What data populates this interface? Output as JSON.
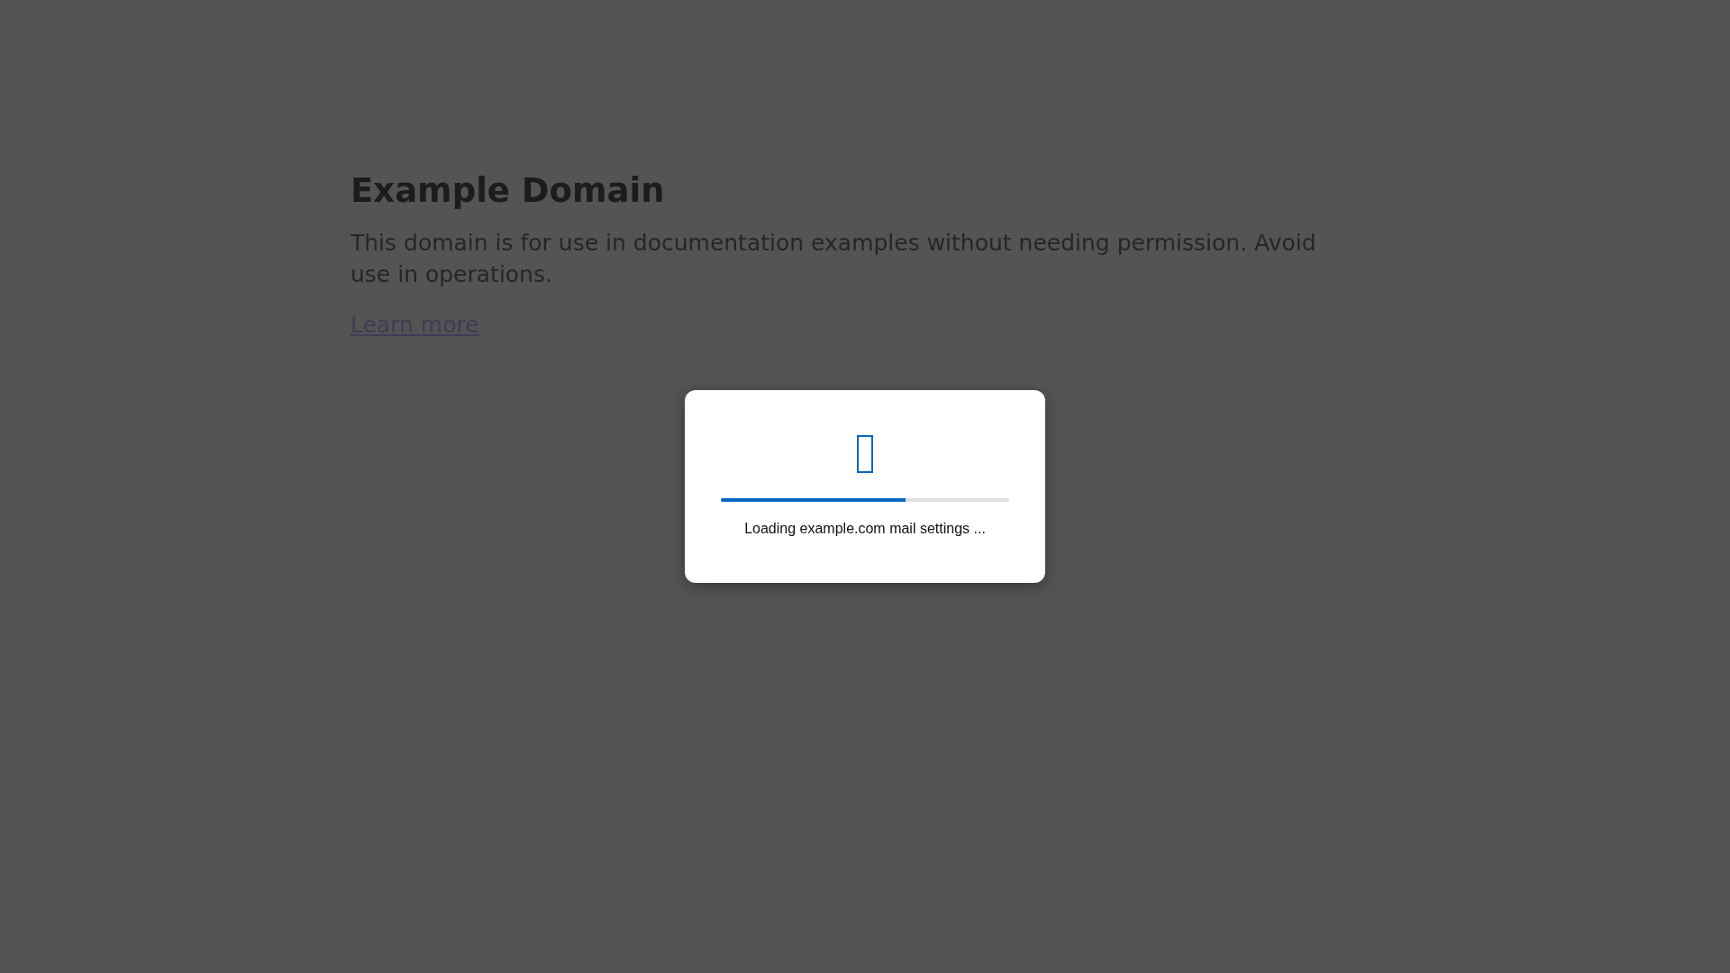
{
  "page": {
    "heading": "Example Domain",
    "paragraph": "This domain is for use in documentation examples without needing permission. Avoid use in operations.",
    "link": "Learn more"
  },
  "dialog": {
    "progress": {
      "level": 0.64
    },
    "message": "Loading example.com mail settings ..."
  }
}
